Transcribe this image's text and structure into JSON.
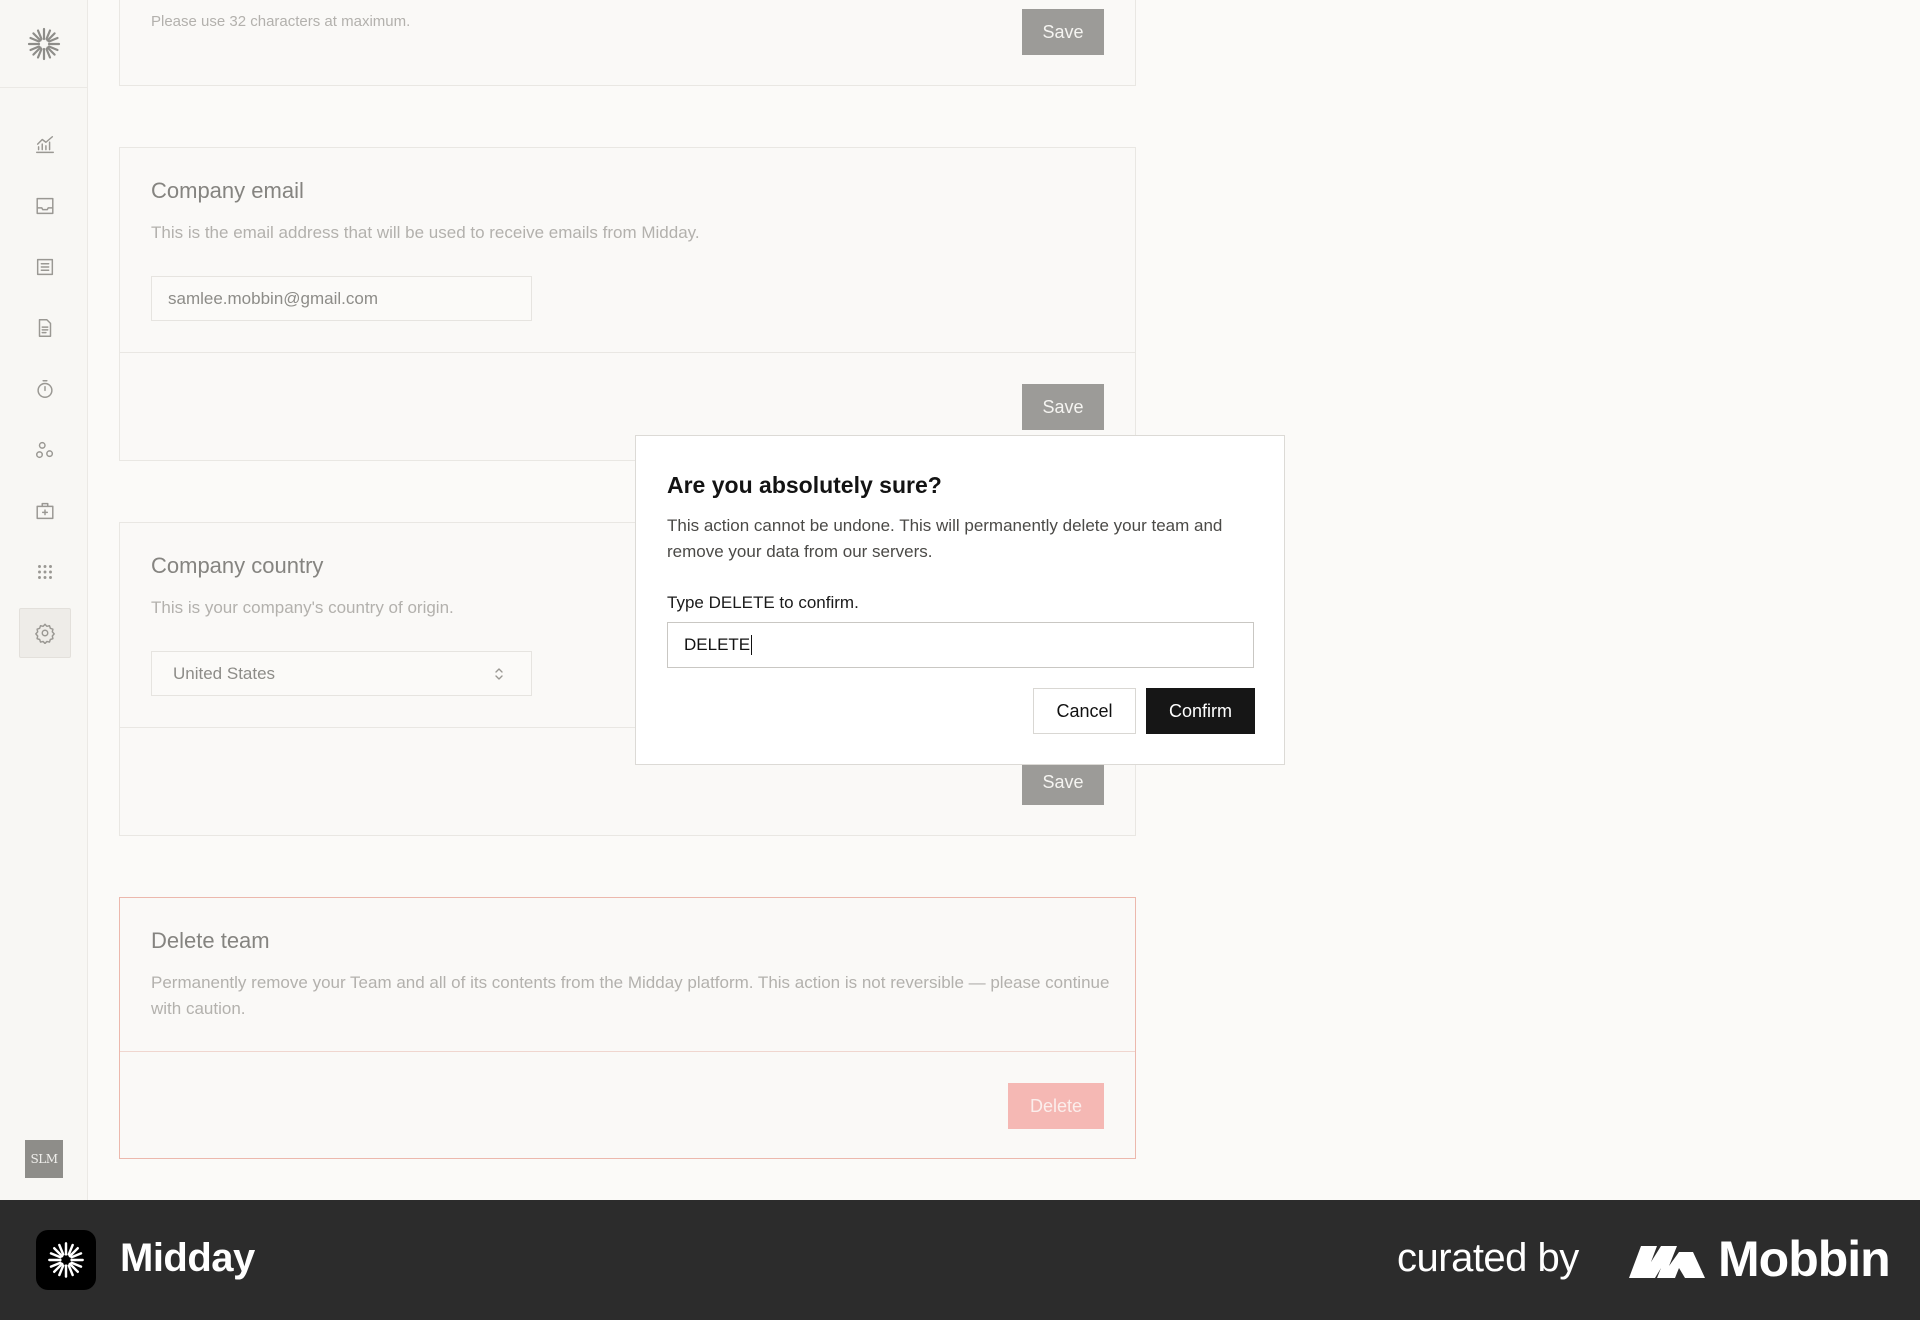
{
  "sidebar": {
    "nav_items": [
      {
        "name": "overview",
        "icon": "chart-icon"
      },
      {
        "name": "inbox",
        "icon": "inbox-icon"
      },
      {
        "name": "transactions",
        "icon": "list-icon"
      },
      {
        "name": "invoices",
        "icon": "document-icon"
      },
      {
        "name": "tracker",
        "icon": "timer-icon"
      },
      {
        "name": "customers",
        "icon": "people-icon"
      },
      {
        "name": "vault",
        "icon": "vault-icon"
      },
      {
        "name": "apps",
        "icon": "grid-icon"
      },
      {
        "name": "settings",
        "icon": "gear-icon",
        "active": true
      }
    ],
    "avatar_initials": "SLM"
  },
  "team_name_card": {
    "hint": "Please use 32 characters at maximum.",
    "save_label": "Save"
  },
  "company_email": {
    "title": "Company email",
    "description": "This is the email address that will be used to receive emails from Midday.",
    "value": "samlee.mobbin@gmail.com",
    "save_label": "Save"
  },
  "company_country": {
    "title": "Company country",
    "description": "This is your company's country of origin.",
    "value": "United States",
    "save_label": "Save"
  },
  "delete_team": {
    "title": "Delete team",
    "description": "Permanently remove your Team and all of its contents from the Midday platform. This action is not reversible — please continue with caution.",
    "delete_label": "Delete"
  },
  "dialog": {
    "title": "Are you absolutely sure?",
    "text": "This action cannot be undone. This will permanently delete your team and remove your data from our servers.",
    "label": "Type DELETE to confirm.",
    "input_value": "DELETE",
    "cancel_label": "Cancel",
    "confirm_label": "Confirm"
  },
  "footer": {
    "app_name": "Midday",
    "curated_by": "curated by",
    "brand": "Mobbin"
  },
  "colors": {
    "accent_dark": "#161616",
    "danger_border": "#ecb8ad",
    "danger_button": "#f5b8b4",
    "footer_bg": "#2c2c2c"
  }
}
